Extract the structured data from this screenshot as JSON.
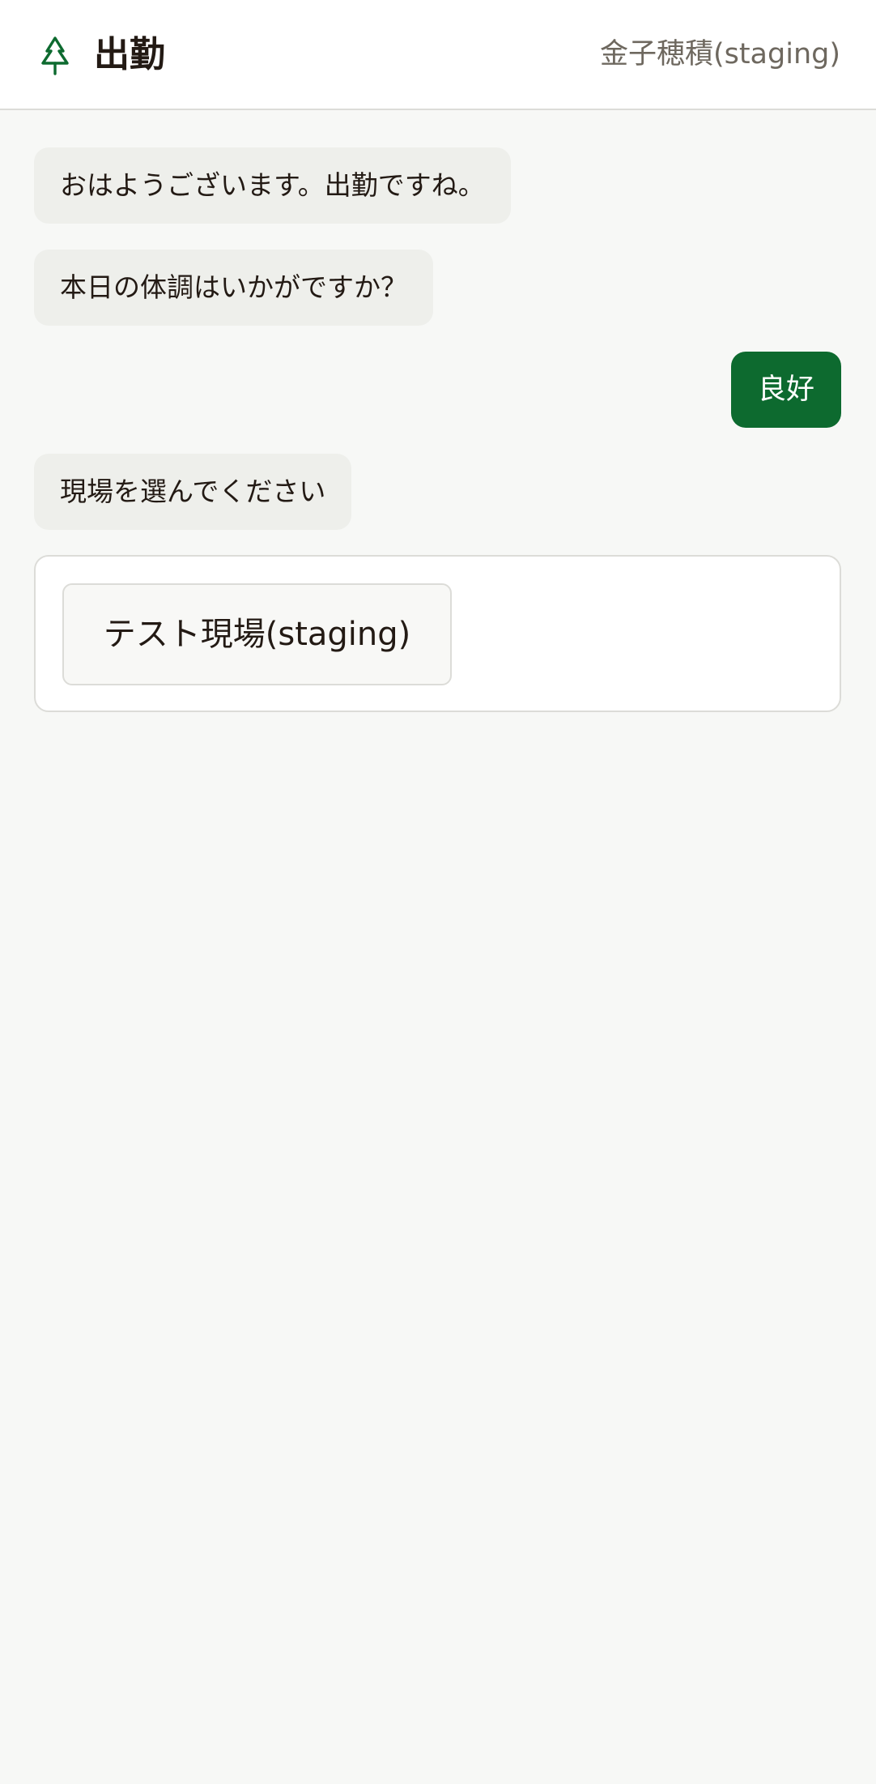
{
  "header": {
    "title": "出勤",
    "user_name": "金子穂積(staging)",
    "logo_icon": "tree-icon",
    "accent_color": "#0d6a2f"
  },
  "chat": {
    "messages": [
      {
        "sender": "bot",
        "text": "おはようございます。出勤ですね。"
      },
      {
        "sender": "bot",
        "text": "本日の体調はいかがですか？"
      },
      {
        "sender": "user",
        "text": "良好"
      },
      {
        "sender": "bot",
        "text": "現場を選んでください"
      }
    ],
    "choices": [
      {
        "label": "テスト現場(staging)"
      }
    ]
  }
}
